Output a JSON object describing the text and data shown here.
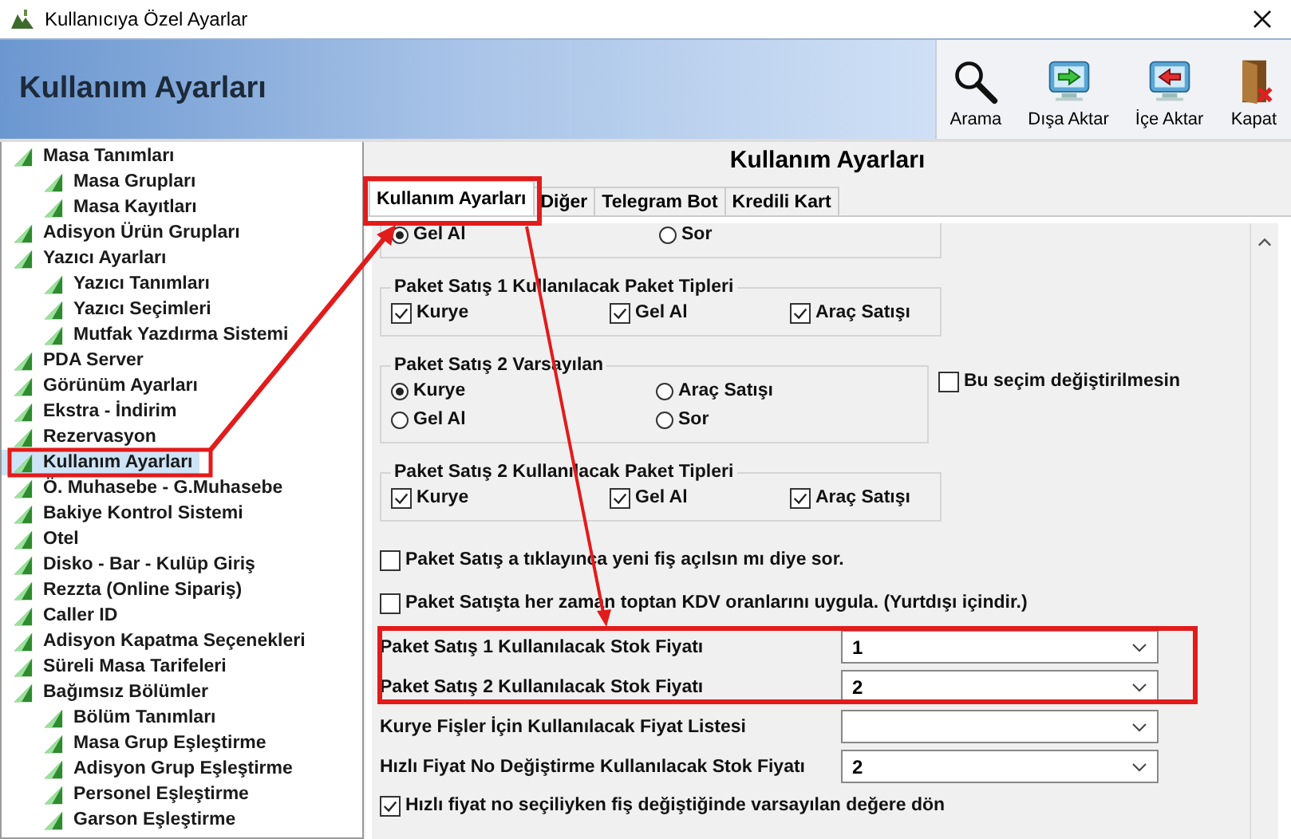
{
  "window": {
    "title": "Kullanıcıya Özel Ayarlar"
  },
  "header": {
    "title": "Kullanım Ayarları"
  },
  "toolbar": [
    {
      "kind": "search",
      "label": "Arama"
    },
    {
      "kind": "export",
      "label": "Dışa Aktar"
    },
    {
      "kind": "import",
      "label": "İçe Aktar"
    },
    {
      "kind": "close",
      "label": "Kapat"
    }
  ],
  "sidebar": {
    "items": [
      {
        "label": "Masa Tanımları",
        "selected": false,
        "children": [
          {
            "label": "Masa Grupları",
            "selected": false
          },
          {
            "label": "Masa Kayıtları",
            "selected": false
          }
        ]
      },
      {
        "label": "Adisyon Ürün Grupları",
        "selected": false
      },
      {
        "label": "Yazıcı Ayarları",
        "selected": false,
        "children": [
          {
            "label": "Yazıcı Tanımları",
            "selected": false
          },
          {
            "label": "Yazıcı Seçimleri",
            "selected": false
          },
          {
            "label": "Mutfak Yazdırma Sistemi",
            "selected": false
          }
        ]
      },
      {
        "label": "PDA Server",
        "selected": false
      },
      {
        "label": "Görünüm Ayarları",
        "selected": false
      },
      {
        "label": "Ekstra - İndirim",
        "selected": false
      },
      {
        "label": "Rezervasyon",
        "selected": false
      },
      {
        "label": "Kullanım Ayarları",
        "selected": true
      },
      {
        "label": "Ö. Muhasebe - G.Muhasebe",
        "selected": false
      },
      {
        "label": "Bakiye Kontrol Sistemi",
        "selected": false
      },
      {
        "label": "Otel",
        "selected": false
      },
      {
        "label": "Disko - Bar - Kulüp Giriş",
        "selected": false
      },
      {
        "label": "Rezzta (Online Sipariş)",
        "selected": false
      },
      {
        "label": "Caller ID",
        "selected": false
      },
      {
        "label": "Adisyon Kapatma Seçenekleri",
        "selected": false
      },
      {
        "label": "Süreli Masa Tarifeleri",
        "selected": false
      },
      {
        "label": "Bağımsız Bölümler",
        "selected": false,
        "children": [
          {
            "label": "Bölüm Tanımları",
            "selected": false
          },
          {
            "label": "Masa Grup Eşleştirme",
            "selected": false
          },
          {
            "label": "Adisyon Grup Eşleştirme",
            "selected": false
          },
          {
            "label": "Personel Eşleştirme",
            "selected": false
          },
          {
            "label": "Garson Eşleştirme",
            "selected": false
          }
        ]
      }
    ]
  },
  "panel": {
    "title": "Kullanım Ayarları"
  },
  "tabs": [
    {
      "label": "Kullanım Ayarları",
      "selected": true
    },
    {
      "label": "Diğer",
      "selected": false
    },
    {
      "label": "Telegram Bot",
      "selected": false
    },
    {
      "label": "Kredili Kart",
      "selected": false
    }
  ],
  "content": [
    {
      "kind": "radio_group",
      "options": [
        {
          "label": "Gel Al",
          "selected": true
        },
        {
          "label": "Sor",
          "selected": false
        }
      ]
    },
    {
      "kind": "check_group",
      "title": "Paket Satış 1 Kullanılacak Paket Tipleri",
      "options": [
        {
          "label": "Kurye",
          "checked": true
        },
        {
          "label": "Gel Al",
          "checked": true
        },
        {
          "label": "Araç Satışı",
          "checked": true
        }
      ]
    },
    {
      "kind": "radio_group",
      "title": "Paket Satış 2 Varsayılan",
      "options": [
        {
          "label": "Kurye",
          "selected": true
        },
        {
          "label": "Araç Satışı",
          "selected": false
        },
        {
          "label": "Gel Al",
          "selected": false
        },
        {
          "label": "Sor",
          "selected": false
        }
      ],
      "side_check": {
        "label": "Bu seçim değiştirilmesin",
        "checked": false
      }
    },
    {
      "kind": "check_group",
      "title": "Paket Satış 2 Kullanılacak Paket Tipleri",
      "options": [
        {
          "label": "Kurye",
          "checked": true
        },
        {
          "label": "Gel Al",
          "checked": true
        },
        {
          "label": "Araç Satışı",
          "checked": true
        }
      ]
    },
    {
      "kind": "check",
      "label": "Paket Satış a tıklayınca yeni fiş açılsın mı diye sor.",
      "checked": false
    },
    {
      "kind": "check",
      "label": "Paket Satışta her zaman toptan KDV oranlarını uygula. (Yurtdışı içindir.)",
      "checked": false
    },
    {
      "kind": "select",
      "label": "Paket Satış 1 Kullanılacak Stok Fiyatı",
      "value": "1"
    },
    {
      "kind": "select",
      "label": "Paket Satış 2 Kullanılacak Stok Fiyatı",
      "value": "2"
    },
    {
      "kind": "select",
      "label": "Kurye Fişler İçin Kullanılacak Fiyat Listesi"
    },
    {
      "kind": "select",
      "label": "Hızlı Fiyat No Değiştirme Kullanılacak Stok Fiyatı",
      "value": "2"
    },
    {
      "kind": "check",
      "label": "Hızlı fiyat no seçiliyken fiş değiştiğinde varsayılan değere dön",
      "checked": true
    }
  ]
}
